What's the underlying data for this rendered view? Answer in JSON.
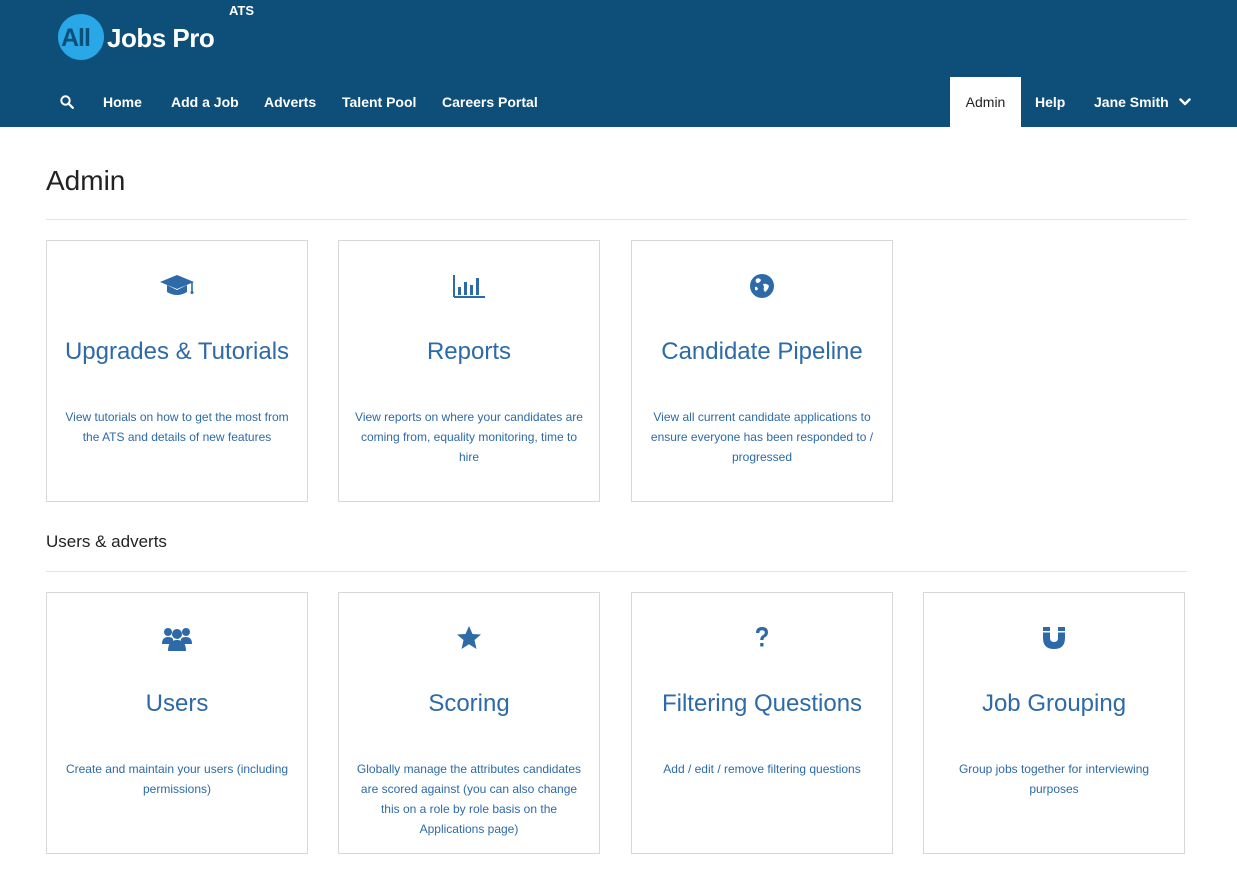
{
  "brand": {
    "logo_all": "All",
    "logo_name": "Jobs Pro",
    "logo_tag": "ATS"
  },
  "nav": {
    "left_items": [
      {
        "label": "Home"
      },
      {
        "label": "Add a Job"
      },
      {
        "label": "Adverts"
      },
      {
        "label": "Talent Pool"
      },
      {
        "label": "Careers Portal"
      }
    ],
    "admin_label": "Admin",
    "help_label": "Help",
    "user_label": "Jane Smith"
  },
  "page": {
    "title": "Admin",
    "section_title": "Users & adverts"
  },
  "cards_top": [
    {
      "icon": "graduation-cap-icon",
      "title": "Upgrades & Tutorials",
      "desc": "View tutorials on how to get the most from the ATS and details of new features"
    },
    {
      "icon": "bar-chart-icon",
      "title": "Reports",
      "desc": "View reports on where your candidates are coming from, equality monitoring, time to hire"
    },
    {
      "icon": "globe-icon",
      "title": "Candidate Pipeline",
      "desc": "View all current candidate applications to ensure everyone has been responded to / progressed"
    }
  ],
  "cards_bottom": [
    {
      "icon": "users-icon",
      "title": "Users",
      "desc": "Create and maintain your users (including permissions)"
    },
    {
      "icon": "star-icon",
      "title": "Scoring",
      "desc": "Globally manage the attributes candidates are scored against (you can also change this on a role by role basis on the Applications page)"
    },
    {
      "icon": "question-icon",
      "title": "Filtering Questions",
      "desc": "Add / edit / remove filtering questions"
    },
    {
      "icon": "magnet-icon",
      "title": "Job Grouping",
      "desc": "Group jobs together for interviewing purposes"
    }
  ],
  "colors": {
    "header": "#0e4f7a",
    "logo_circle": "#2aa7e6",
    "accent": "#2d6aa7"
  }
}
